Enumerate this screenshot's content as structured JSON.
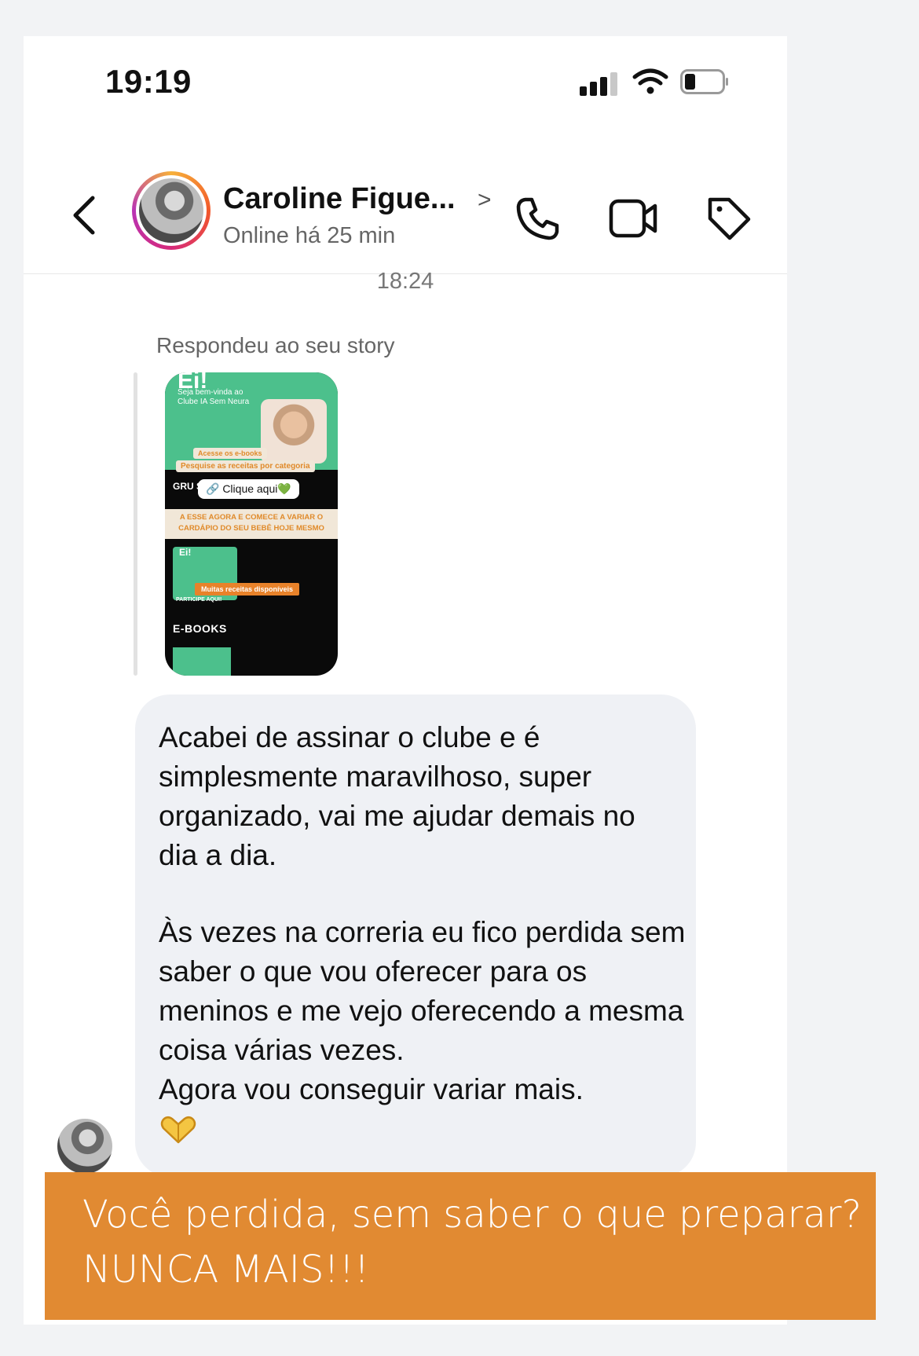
{
  "status_bar": {
    "time": "19:19"
  },
  "header": {
    "contact_name": "Caroline Figue...",
    "contact_status": "Online há 25 min"
  },
  "chat": {
    "timestamp": "18:24",
    "replied_label": "Respondeu ao seu story",
    "story_preview": {
      "title": "Ei!",
      "welcome": "Seja bem-vinda ao Clube IA Sem Neura",
      "ebooks_pill": "Acesse os e-books",
      "search_pill": "Pesquise as receitas por categoria",
      "group_label": "GRU SUP",
      "link_label": "🔗 Clique aqui💚",
      "banner_line1": "A ESSE AGORA E COMECE A VARIAR O",
      "banner_line2": "CARDÁPIO DO SEU BEBÊ HOJE MESMO",
      "card_title": "Ei!",
      "recipes_pill": "Muitas receitas disponíveis",
      "participe": "PARTICIPE AQUI!",
      "ebooks_label": "E-BOOKS"
    },
    "message": {
      "paragraph1": "Acabei de assinar o clube e é simplesmente maravilhoso, super organizado, vai me ajudar demais no dia a dia.",
      "paragraph2": "Às vezes na correria eu fico perdida sem saber o que vou oferecer para os meninos e me vejo oferecendo a mesma coisa várias vezes.",
      "paragraph3": "Agora vou conseguir variar mais.",
      "emoji_icon": "heart-hands-icon"
    }
  },
  "promo": {
    "line1": "Você perdida, sem saber o que preparar?",
    "line2": "NUNCA MAIS!!!",
    "color": "#e18a32"
  }
}
